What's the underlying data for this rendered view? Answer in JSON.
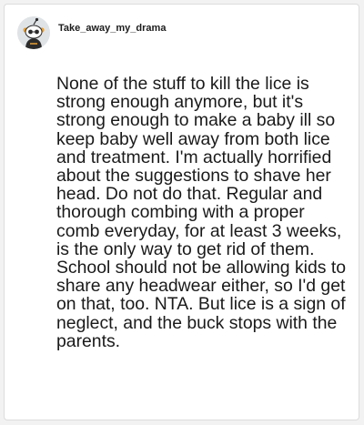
{
  "post": {
    "username": "Take_away_my_drama",
    "avatar_icon": "reddit-snoo-avatar-icon",
    "comment": "None of the stuff to kill the lice is strong enough anymore, but it's strong enough to make a baby ill so keep baby well away from both lice and treatment. I'm actually horrified about the suggestions to shave her head. Do not do that. Regular and thorough combing with a proper comb everyday, for at least 3 weeks, is the only way to get rid of them. School should not be allowing kids to share any headwear either, so I'd get on that, too. NTA. But lice is a sign of neglect, and the buck stops with the parents."
  },
  "colors": {
    "background": "#f2f2f2",
    "card": "#ffffff",
    "text": "#1a1a1a",
    "avatar_accent": "#e8a13a"
  }
}
